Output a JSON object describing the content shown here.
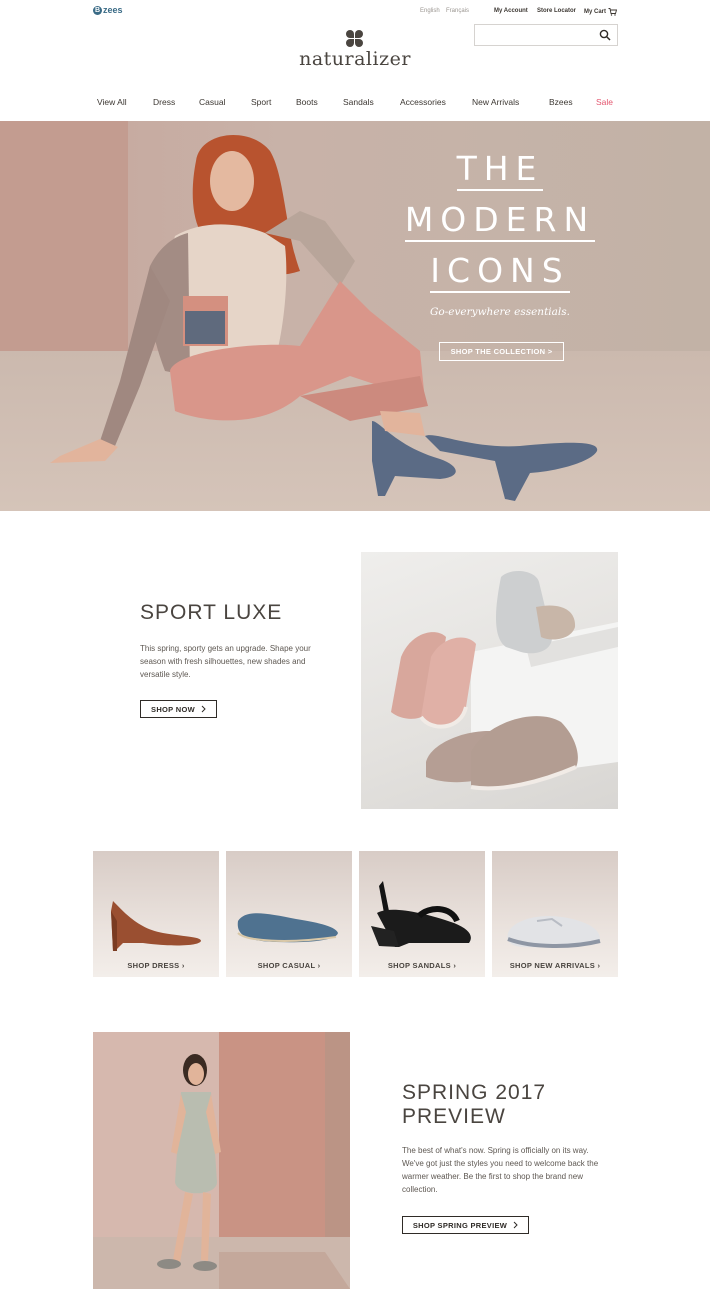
{
  "topbar": {
    "bzees_logo": "zees",
    "languages": [
      "English",
      "Français"
    ],
    "my_account": "My Account",
    "store_locator": "Store Locator",
    "my_cart": "My Cart"
  },
  "brand": {
    "logo_text": "naturalizer"
  },
  "search": {
    "placeholder": "",
    "value": ""
  },
  "nav": {
    "items": [
      "View All",
      "Dress",
      "Casual",
      "Sport",
      "Boots",
      "Sandals",
      "Accessories",
      "New Arrivals",
      "Bzees",
      "Sale"
    ]
  },
  "hero": {
    "title_lines": [
      "THE",
      "MODERN",
      "ICONS"
    ],
    "subtitle": "Go-everywhere essentials.",
    "cta": "SHOP THE COLLECTION >"
  },
  "sport_luxe": {
    "title": "SPORT LUXE",
    "text": "This spring, sporty gets an upgrade. Shape your season with fresh silhouettes, new shades and versatile style.",
    "cta": "SHOP NOW"
  },
  "tiles": [
    {
      "label": "SHOP DRESS"
    },
    {
      "label": "SHOP CASUAL"
    },
    {
      "label": "SHOP SANDALS"
    },
    {
      "label": "SHOP NEW ARRIVALS"
    }
  ],
  "spring": {
    "title": "SPRING 2017 PREVIEW",
    "text": "The best of what's now. Spring is officially on its way. We've got just the styles you need to welcome back the warmer weather. Be the first to shop the brand new collection.",
    "cta": "SHOP SPRING PREVIEW"
  },
  "colors": {
    "sale": "#e4566f",
    "text_dark": "#4a4540",
    "bzees_blue": "#3a6b86"
  },
  "icons": {
    "search": "search-icon",
    "cart": "cart-icon",
    "chevron": "chevron-right-icon"
  }
}
